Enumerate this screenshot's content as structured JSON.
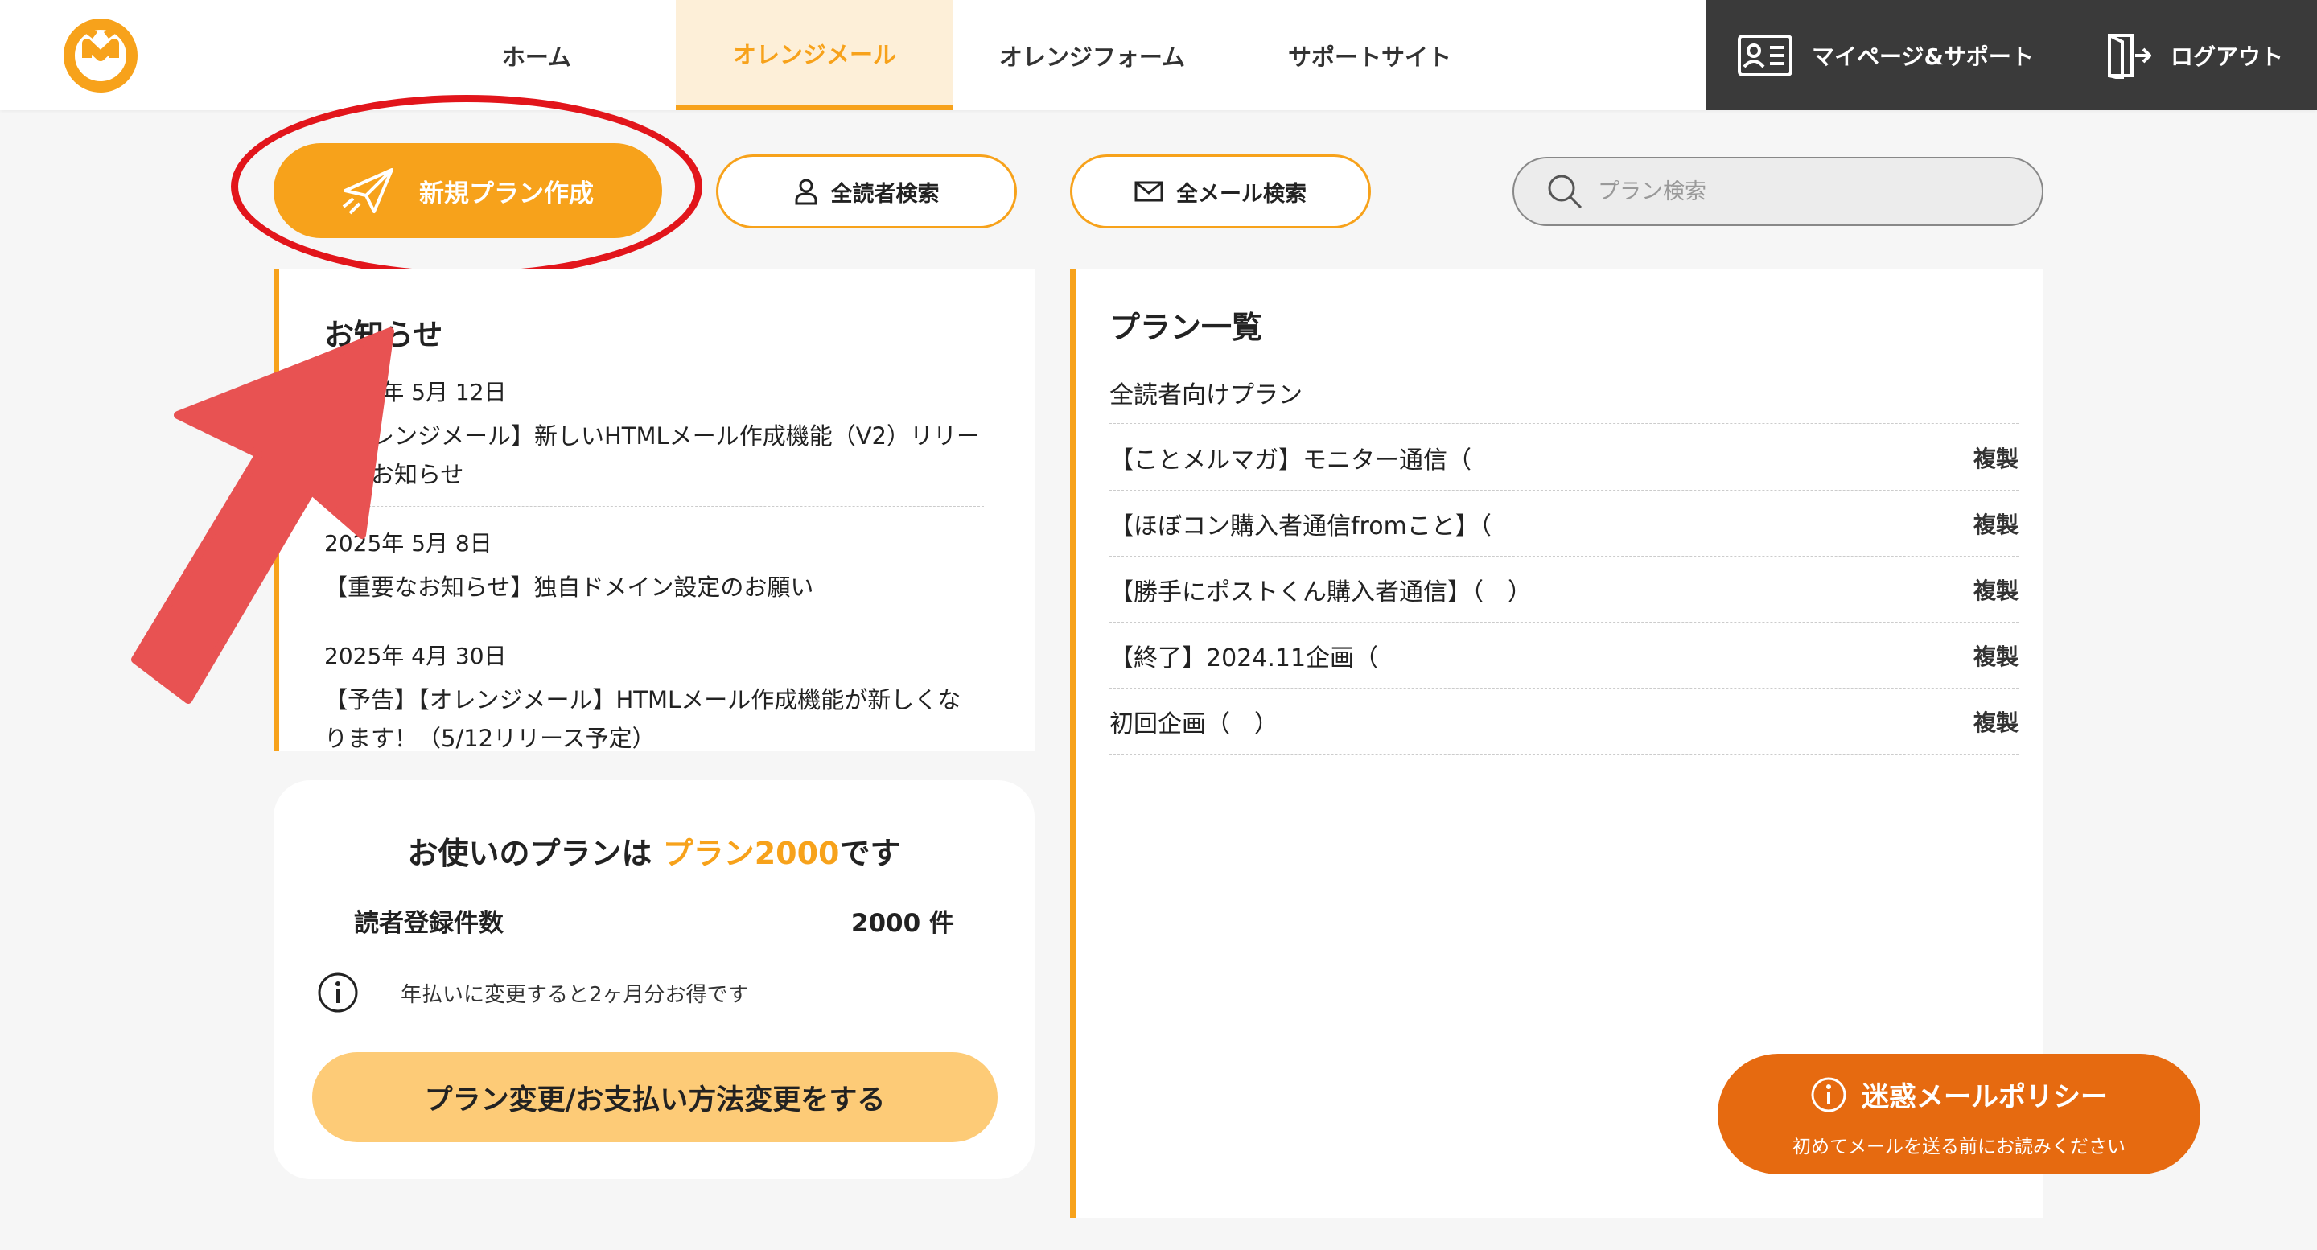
{
  "header": {
    "nav": {
      "home": "ホーム",
      "orange_mail": "オレンジメール",
      "orange_form": "オレンジフォーム",
      "support_site": "サポートサイト"
    },
    "mypage": "マイページ&サポート",
    "logout": "ログアウト"
  },
  "actions": {
    "new_plan": "新規プラン作成",
    "all_readers_search": "全読者検索",
    "all_mail_search": "全メール検索",
    "plan_search_placeholder": "プラン検索"
  },
  "notices": {
    "title": "お知らせ",
    "items": [
      {
        "date": "2025年 5月 12日",
        "text": "【オレンジメール】新しいHTMLメール作成機能（V2）リリースのお知らせ"
      },
      {
        "date": "2025年 5月 8日",
        "text": "【重要なお知らせ】独自ドメイン設定のお願い"
      },
      {
        "date": "2025年 4月 30日",
        "text": "【予告】【オレンジメール】HTMLメール作成機能が新しくなります！（5/12リリース予定）"
      }
    ]
  },
  "plan_info": {
    "heading_prefix": "お使いのプランは ",
    "plan_name": "プラン2000",
    "heading_suffix": "です",
    "readers_label": "読者登録件数",
    "readers_value": "2000 件",
    "annual_note": "年払いに変更すると2ヶ月分お得です",
    "change_button": "プラン変更/お支払い方法変更をする"
  },
  "plan_list": {
    "title": "プラン一覧",
    "subtitle": "全読者向けプラン",
    "copy_label": "複製",
    "plans": [
      {
        "name": "【ことメルマガ】モニター通信（"
      },
      {
        "name": "【ほぼコン購入者通信fromこと】（"
      },
      {
        "name": "【勝手にポストくん購入者通信】（　）"
      },
      {
        "name": "【終了】2024.11企画（"
      },
      {
        "name": "初回企画（　）"
      }
    ]
  },
  "policy": {
    "title": "迷惑メールポリシー",
    "subtitle": "初めてメールを送る前にお読みください"
  },
  "colors": {
    "accent": "#f7a21b",
    "dark_header": "#3a3a3a",
    "policy": "#e66a10",
    "highlight_red": "#e2151b",
    "arrow_red": "#e85252"
  }
}
